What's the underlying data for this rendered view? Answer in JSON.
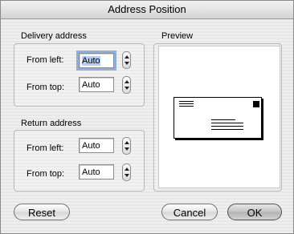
{
  "window": {
    "title": "Address Position"
  },
  "delivery": {
    "heading": "Delivery address",
    "from_left_label": "From left:",
    "from_left_value": "Auto",
    "from_top_label": "From top:",
    "from_top_value": "Auto"
  },
  "return": {
    "heading": "Return address",
    "from_left_label": "From left:",
    "from_left_value": "Auto",
    "from_top_label": "From top:",
    "from_top_value": "Auto"
  },
  "preview": {
    "heading": "Preview"
  },
  "buttons": {
    "reset": "Reset",
    "cancel": "Cancel",
    "ok": "OK"
  },
  "icons": {
    "stepper": "stepper-arrows-icon",
    "envelope": "envelope-preview-icon"
  }
}
